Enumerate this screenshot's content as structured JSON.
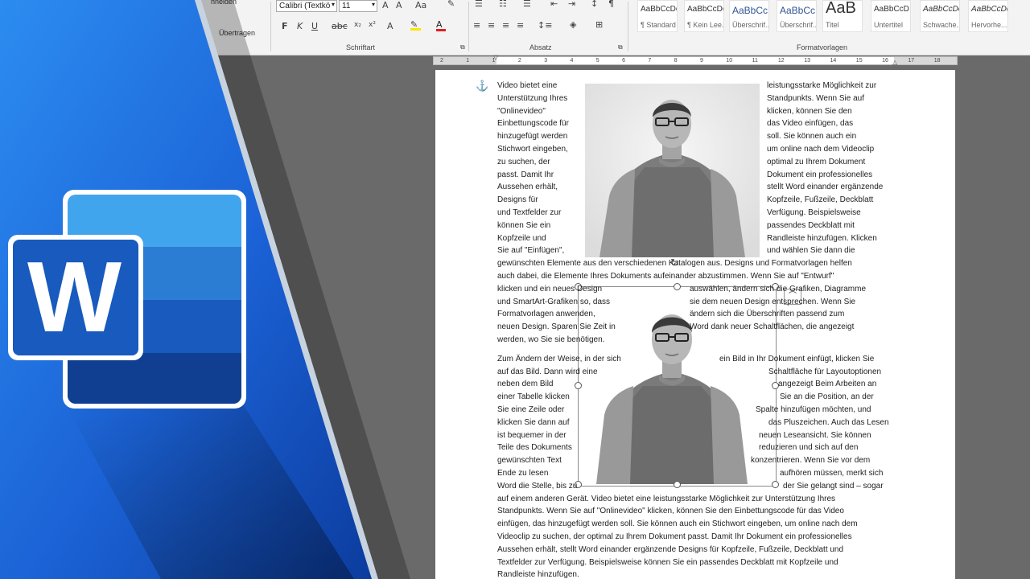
{
  "ribbon": {
    "clipboard": {
      "cut_label": "hneiden",
      "format_painter_label": "Übertragen"
    },
    "font": {
      "name": "Calibri (Textkö",
      "size": "11",
      "group_label": "Schriftart"
    },
    "paragraph": {
      "group_label": "Absatz"
    },
    "styles": {
      "group_label": "Formatvorlagen",
      "items": [
        {
          "preview": "AaBbCcDc",
          "name": "¶ Standard"
        },
        {
          "preview": "AaBbCcDc",
          "name": "¶ Kein Lee..."
        },
        {
          "preview": "AaBbCc",
          "name": "Überschrif..."
        },
        {
          "preview": "AaBbCcI",
          "name": "Überschrif..."
        },
        {
          "preview": "AaB",
          "name": "Titel"
        },
        {
          "preview": "AaBbCcD",
          "name": "Untertitel"
        },
        {
          "preview": "AaBbCcDc",
          "name": "Schwache..."
        },
        {
          "preview": "AaBbCcDc",
          "name": "Hervorhe..."
        }
      ]
    }
  },
  "ruler": {
    "ticks": [
      "2",
      "1",
      "1",
      "2",
      "3",
      "4",
      "5",
      "6",
      "7",
      "8",
      "9",
      "10",
      "11",
      "12",
      "13",
      "14",
      "15",
      "16",
      "17",
      "18"
    ]
  },
  "document": {
    "block1_left": [
      "Video bietet eine",
      "Unterstützung Ihres",
      "\"Onlinevideo\"",
      "Einbettungscode für",
      "hinzugefügt werden",
      "Stichwort eingeben,",
      "zu suchen, der",
      "passt. Damit Ihr",
      "Aussehen erhält,",
      "Designs für",
      "und Textfelder zur",
      "können Sie ein",
      "Kopfzeile und",
      "Sie auf \"Einfügen\","
    ],
    "block1_right": [
      "leistungsstarke Möglichkeit zur",
      "Standpunkts. Wenn Sie auf",
      "klicken, können Sie den",
      "das Video einfügen, das",
      "soll. Sie können auch ein",
      "um online nach dem Videoclip",
      "optimal zu Ihrem Dokument",
      "Dokument ein professionelles",
      "stellt Word einander ergänzende",
      "Kopfzeile, Fußzeile, Deckblatt",
      "Verfügung. Beispielsweise",
      "passendes Deckblatt mit",
      "Randleiste hinzufügen. Klicken",
      "und wählen Sie dann die"
    ],
    "block2_full": [
      "gewünschten Elemente aus den verschiedenen Katalogen aus. Designs und Formatvorlagen helfen",
      "auch dabei, die Elemente Ihres Dokuments aufeinander abzustimmen. Wenn Sie auf \"Entwurf\""
    ],
    "block3_left": [
      "klicken und ein neues Design",
      "und SmartArt-Grafiken so, dass",
      "Formatvorlagen anwenden,",
      "neuen Design. Sparen Sie Zeit in",
      "werden, wo Sie sie benötigen."
    ],
    "block3_right": [
      "auswählen, ändern sich die Grafiken, Diagramme",
      "sie dem neuen Design entsprechen. Wenn Sie",
      "ändern sich die Überschriften passend zum",
      "Word dank neuer Schaltflächen, die angezeigt",
      ""
    ],
    "block4_left": [
      "Zum Ändern der Weise, in der sich",
      "auf das Bild. Dann wird eine",
      "neben dem Bild",
      "einer Tabelle klicken",
      "Sie eine Zeile oder",
      "klicken Sie dann auf",
      "ist bequemer in der",
      "Teile des Dokuments",
      "gewünschten Text",
      "Ende zu lesen",
      "Word die Stelle, bis zu"
    ],
    "block4_right": [
      "ein Bild in Ihr Dokument einfügt, klicken Sie",
      "Schaltfläche für Layoutoptionen",
      "angezeigt Beim Arbeiten an",
      "Sie an die Position, an der",
      "Spalte hinzufügen möchten, und",
      "das Pluszeichen. Auch das Lesen",
      "neuen Leseansicht. Sie können",
      "reduzieren und sich auf den",
      "konzentrieren. Wenn Sie vor dem",
      "aufhören müssen, merkt sich",
      "der Sie gelangt sind – sogar"
    ],
    "block5_full": [
      "auf einem anderen Gerät. Video bietet eine leistungsstarke Möglichkeit zur Unterstützung Ihres",
      "Standpunkts. Wenn Sie auf \"Onlinevideo\" klicken, können Sie den Einbettungscode für das Video",
      "einfügen, das hinzugefügt werden soll. Sie können auch ein Stichwort eingeben, um online nach dem",
      "Videoclip zu suchen, der optimal zu Ihrem Dokument passt. Damit Ihr Dokument ein professionelles",
      "Aussehen erhält, stellt Word einander ergänzende Designs für Kopfzeile, Fußzeile, Deckblatt und",
      "Textfelder zur Verfügung. Beispielsweise können Sie ein passendes Deckblatt mit Kopfzeile und",
      "Randleiste hinzufügen."
    ]
  },
  "brand": {
    "logo_letter": "W"
  },
  "colors": {
    "brand_blue": "#1b5fd0",
    "page_bg": "#6a6a6a",
    "ribbon_bg": "#f3f3f3"
  }
}
